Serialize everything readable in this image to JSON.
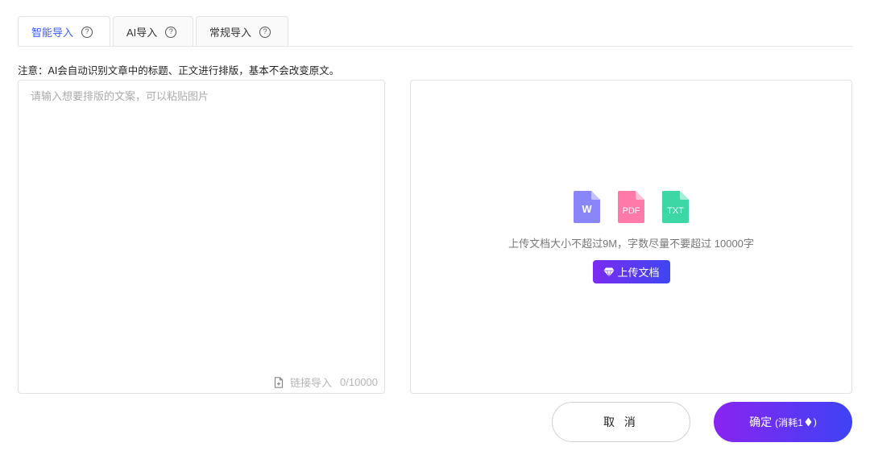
{
  "tabs": [
    {
      "label": "智能导入",
      "active": true,
      "icon": "help-circle-icon"
    },
    {
      "label": "AI导入",
      "active": false,
      "icon": "help-circle-icon"
    },
    {
      "label": "常规导入",
      "active": false,
      "icon": "help-circle-icon"
    }
  ],
  "notice": "注意：AI会自动识别文章中的标题、正文进行排版，基本不会改变原文。",
  "editor": {
    "placeholder": "请输入想要排版的文案，可以粘贴图片",
    "link_import_label": "链接导入",
    "char_count": "0/10000"
  },
  "upload": {
    "file_types": [
      {
        "label": "W",
        "color": "#8b86f8",
        "icon": "word-file-icon"
      },
      {
        "label": "PDF",
        "color": "#ff7aa8",
        "icon": "pdf-file-icon"
      },
      {
        "label": "TXT",
        "color": "#3dd7a6",
        "icon": "txt-file-icon"
      }
    ],
    "hint": "上传文档大小不超过9M，字数尽量不要超过 10000字",
    "button_label": "上传文档"
  },
  "footer": {
    "cancel_label": "取 消",
    "confirm_label": "确定",
    "confirm_cost_prefix": "(消耗1",
    "confirm_cost_suffix": ")"
  },
  "colors": {
    "accent": "#3b5cff",
    "gradient_start": "#8a24f0",
    "gradient_end": "#3e43f5"
  }
}
